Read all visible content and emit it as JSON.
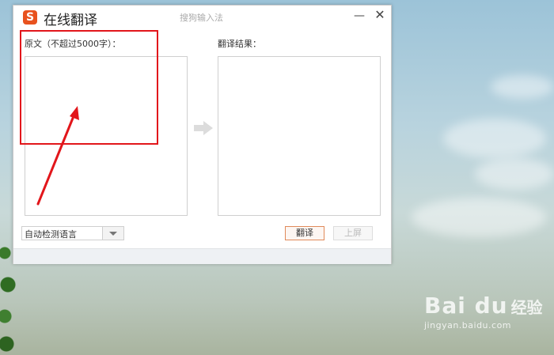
{
  "window": {
    "logo_glyph": "S",
    "title": "在线翻译",
    "brand": "搜狗输入法",
    "minimize_glyph": "—",
    "close_glyph": "✕"
  },
  "source": {
    "label": "原文（不超过5000字）：",
    "value": ""
  },
  "result": {
    "label": "翻译结果：",
    "value": ""
  },
  "language_select": {
    "selected": "自动检测语言"
  },
  "buttons": {
    "translate": "翻译",
    "screen": "上屏"
  },
  "watermark": {
    "logo": "Bai du",
    "jingyan": "经验",
    "url": "jingyan.baidu.com"
  },
  "colors": {
    "accent": "#e8521f",
    "annotation": "#e2161b"
  }
}
